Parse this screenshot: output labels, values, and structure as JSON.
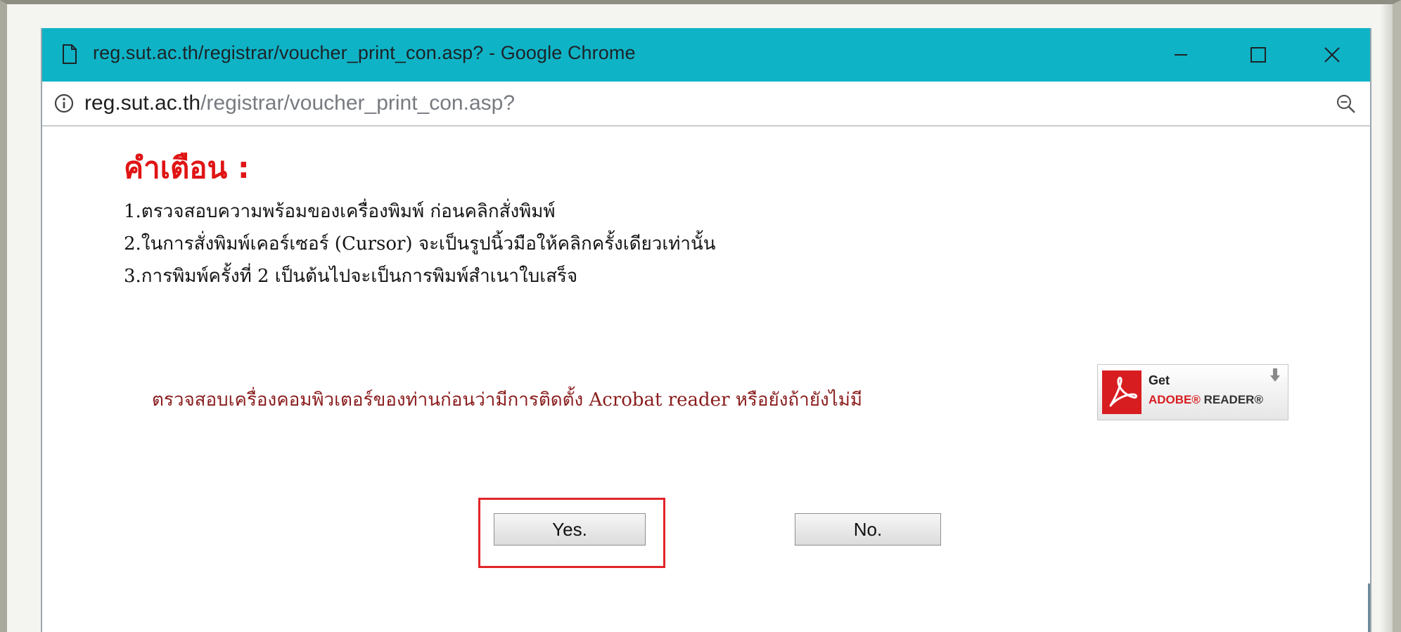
{
  "window": {
    "title": "reg.sut.ac.th/registrar/voucher_print_con.asp? - Google Chrome"
  },
  "address": {
    "host": "reg.sut.ac.th",
    "path": "/registrar/voucher_print_con.asp?"
  },
  "warning": {
    "title": "คำเตือน :",
    "rules": [
      "1.ตรวจสอบความพร้อมของเครื่องพิมพ์ ก่อนคลิกสั่งพิมพ์",
      "2.ในการสั่งพิมพ์เคอร์เซอร์ (Cursor) จะเป็นรูปนิ้วมือให้คลิกครั้งเดียวเท่านั้น",
      "3.การพิมพ์ครั้งที่ 2 เป็นต้นไปจะเป็นการพิมพ์สำเนาใบเสร็จ"
    ]
  },
  "acrobat": {
    "note": "ตรวจสอบเครื่องคอมพิวเตอร์ของท่านก่อนว่ามีการติดตั้ง Acrobat reader หรือยังถ้ายังไม่มี",
    "badge_get": "Get",
    "badge_adobe": "ADOBE®",
    "badge_reader": "READER®"
  },
  "buttons": {
    "yes": "Yes.",
    "no": "No."
  },
  "colors": {
    "titlebar": "#0fb3c6",
    "warning_title": "#e01414",
    "note_text": "#8a1d1d",
    "highlight_box": "#e1252a"
  },
  "icons": {
    "page": "page-icon",
    "info": "info-icon",
    "zoom": "zoom-icon",
    "minimize": "minimize-icon",
    "maximize": "maximize-icon",
    "close": "close-icon",
    "adobe": "adobe-reader-logo",
    "download": "download-arrow-icon"
  }
}
